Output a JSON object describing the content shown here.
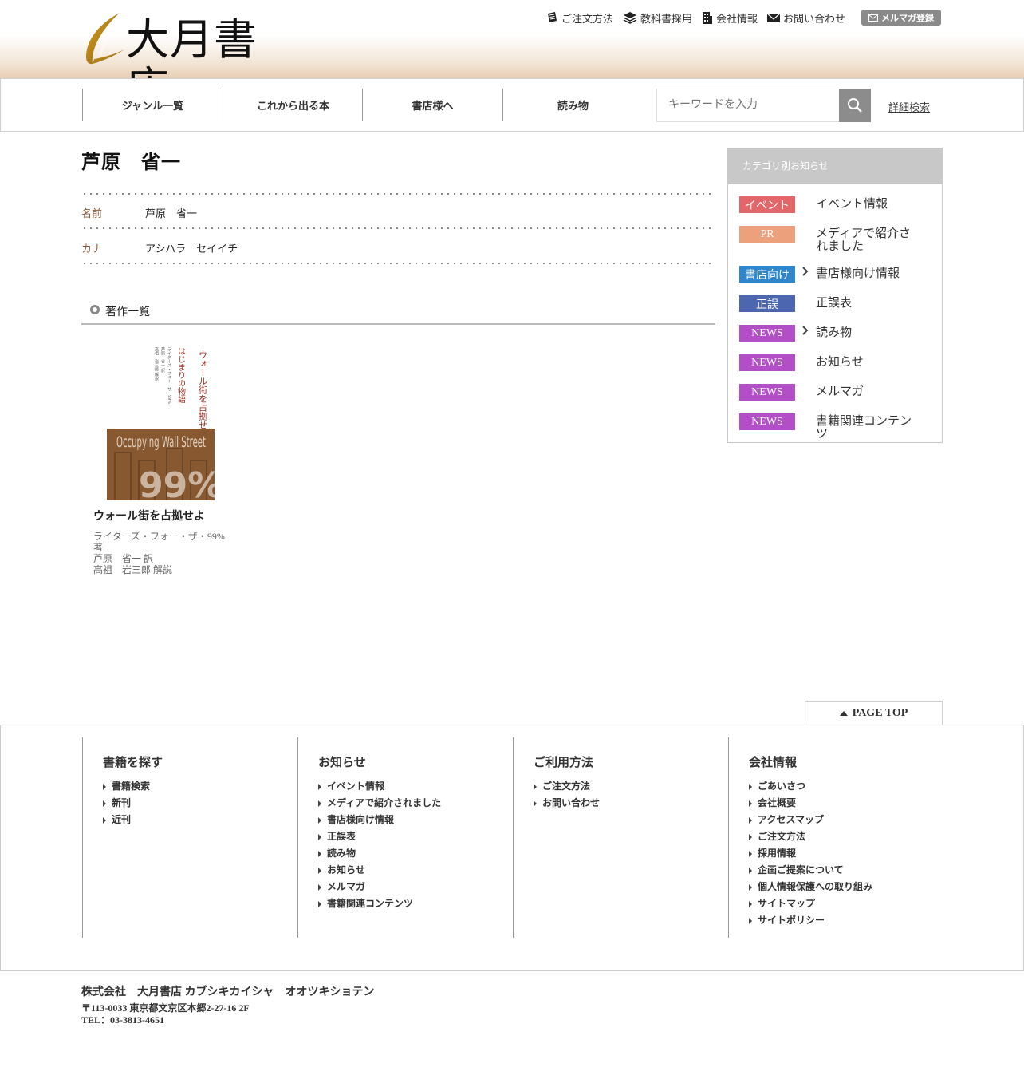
{
  "header": {
    "logo_text": "大月書店",
    "utility_links": [
      {
        "label": "ご注文方法",
        "icon": "order-doc-icon"
      },
      {
        "label": "教科書採用",
        "icon": "books-icon"
      },
      {
        "label": "会社情報",
        "icon": "building-icon"
      },
      {
        "label": "お問い合わせ",
        "icon": "envelope-icon"
      }
    ],
    "newsletter_button": "メルマガ登録"
  },
  "nav": {
    "items": [
      "ジャンル一覧",
      "これから出る本",
      "書店様へ",
      "読み物"
    ],
    "search_placeholder": "キーワードを入力",
    "advanced_search": "詳細検索"
  },
  "author": {
    "title": "芦原　省一",
    "fields": [
      {
        "label": "名前",
        "value": "芦原　省一"
      },
      {
        "label": "カナ",
        "value": "アシハラ　セイイチ"
      }
    ]
  },
  "works": {
    "heading": "著作一覧",
    "books": [
      {
        "title": "ウォール街を占拠せよ",
        "cover_title_jp": "ウォール街を占拠せよ",
        "cover_subtitle_jp": "はじまりの物語",
        "cover_title_en": "Occupying Wall Street",
        "cover_big": "99%",
        "credits": [
          "ライターズ・フォー・ザ・99%",
          "著",
          "芦原　省一 訳",
          "高祖　岩三郎 解説"
        ]
      }
    ]
  },
  "sidebar": {
    "heading": "カテゴリ別お知らせ",
    "items": [
      {
        "badge": "イベント",
        "label": "イベント情報",
        "color": "#e2666a",
        "arrow": false
      },
      {
        "badge": "PR",
        "label": "メディアで紹介されました",
        "color": "#eda07c",
        "arrow": false
      },
      {
        "badge": "書店向け",
        "label": "書店様向け情報",
        "color": "#2f86cc",
        "arrow": true
      },
      {
        "badge": "正誤",
        "label": "正誤表",
        "color": "#4d66b0",
        "arrow": false
      },
      {
        "badge": "NEWS",
        "label": "読み物",
        "color": "#b24fc7",
        "arrow": true
      },
      {
        "badge": "NEWS",
        "label": "お知らせ",
        "color": "#b24fc7",
        "arrow": false
      },
      {
        "badge": "NEWS",
        "label": "メルマガ",
        "color": "#b24fc7",
        "arrow": false
      },
      {
        "badge": "NEWS",
        "label": "書籍関連コンテンツ",
        "color": "#b24fc7",
        "arrow": false
      }
    ]
  },
  "page_top": "PAGE TOP",
  "footer": {
    "columns": [
      {
        "title": "書籍を探す",
        "links": [
          "書籍検索",
          "新刊",
          "近刊"
        ]
      },
      {
        "title": "お知らせ",
        "links": [
          "イベント情報",
          "メディアで紹介されました",
          "書店様向け情報",
          "正誤表",
          "読み物",
          "お知らせ",
          "メルマガ",
          "書籍関連コンテンツ"
        ]
      },
      {
        "title": "ご利用方法",
        "links": [
          "ご注文方法",
          "お問い合わせ"
        ]
      },
      {
        "title": "会社情報",
        "links": [
          "ごあいさつ",
          "会社概要",
          "アクセスマップ",
          "ご注文方法",
          "採用情報",
          "企画ご提案について",
          "個人情報保護への取り組み",
          "サイトマップ",
          "サイトポリシー"
        ]
      }
    ],
    "company_name": "株式会社　大月書店 カブシキカイシャ　オオツキショテン",
    "address": "〒113-0033 東京都文京区本郷2-27-16 2F",
    "tel": "TEL：03-3813-4651"
  }
}
